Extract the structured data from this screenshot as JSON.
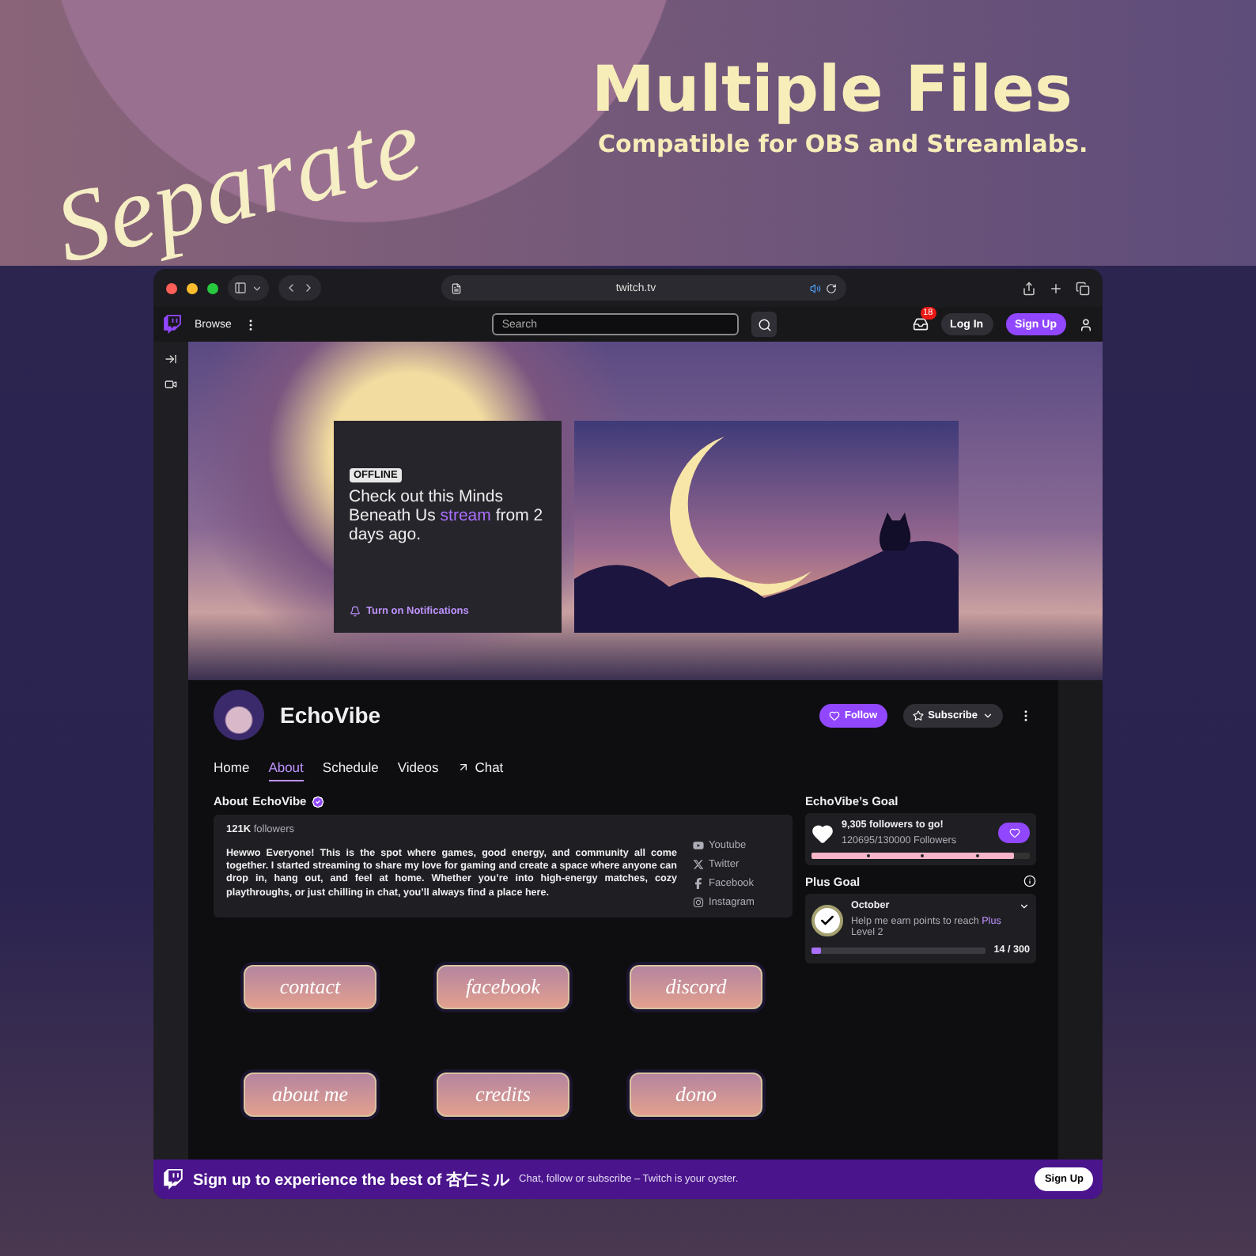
{
  "promo": {
    "script_title": "Separate",
    "title": "Multiple Files",
    "subtitle": "Compatible for OBS and Streamlabs."
  },
  "browser": {
    "url": "twitch.tv"
  },
  "nav": {
    "browse": "Browse",
    "search_placeholder": "Search",
    "notification_count": "18",
    "login": "Log In",
    "signup": "Sign Up"
  },
  "offline_card": {
    "badge": "OFFLINE",
    "text_start": "Check out this Minds Beneath Us",
    "link": "stream",
    "text_end": "from 2 days ago.",
    "notify": "Turn on Notifications"
  },
  "channel": {
    "name": "EchoVibe",
    "follow": "Follow",
    "subscribe": "Subscribe"
  },
  "tabs": [
    {
      "label": "Home",
      "selected": false,
      "kind": "page"
    },
    {
      "label": "About",
      "selected": true,
      "kind": "page"
    },
    {
      "label": "Schedule",
      "selected": false,
      "kind": "page"
    },
    {
      "label": "Videos",
      "selected": false,
      "kind": "page"
    },
    {
      "label": "Chat",
      "selected": false,
      "kind": "popout"
    }
  ],
  "about": {
    "heading": "About",
    "name": "EchoVibe",
    "verified": true,
    "followers_count": "121K",
    "followers_label": "followers",
    "bio": "Hewwo Everyone! This is the spot where games, good energy, and community all come together. I started streaming to share my love for gaming and create a space where anyone can drop in, hang out, and feel at home. Whether you’re into high-energy matches, cozy playthroughs, or just chilling in chat, you’ll always find a place here.",
    "socials": [
      {
        "kind": "youtube",
        "label": "Youtube"
      },
      {
        "kind": "x",
        "label": "Twitter"
      },
      {
        "kind": "facebook",
        "label": "Facebook"
      },
      {
        "kind": "instagram",
        "label": "Instagram"
      }
    ]
  },
  "panels": [
    {
      "label": "contact"
    },
    {
      "label": "facebook"
    },
    {
      "label": "discord"
    },
    {
      "label": "about me"
    },
    {
      "label": "credits"
    },
    {
      "label": "dono"
    }
  ],
  "goal": {
    "heading": "EchoVibe’s Goal",
    "title": "9,305 followers to go!",
    "progress": "120695/130000 Followers",
    "level": 0.93
  },
  "plus_goal": {
    "heading": "Plus Goal",
    "month": "October",
    "text_start": "Help me earn points to reach",
    "highlight": "Plus",
    "text_end": "Level 2",
    "reading": "14 / 300",
    "level": 0.05
  },
  "signup_bar": {
    "lead": "Sign up to experience the best of 杏仁ミル",
    "tail": "Chat, follow or subscribe – Twitch is your oyster.",
    "button": "Sign Up"
  }
}
